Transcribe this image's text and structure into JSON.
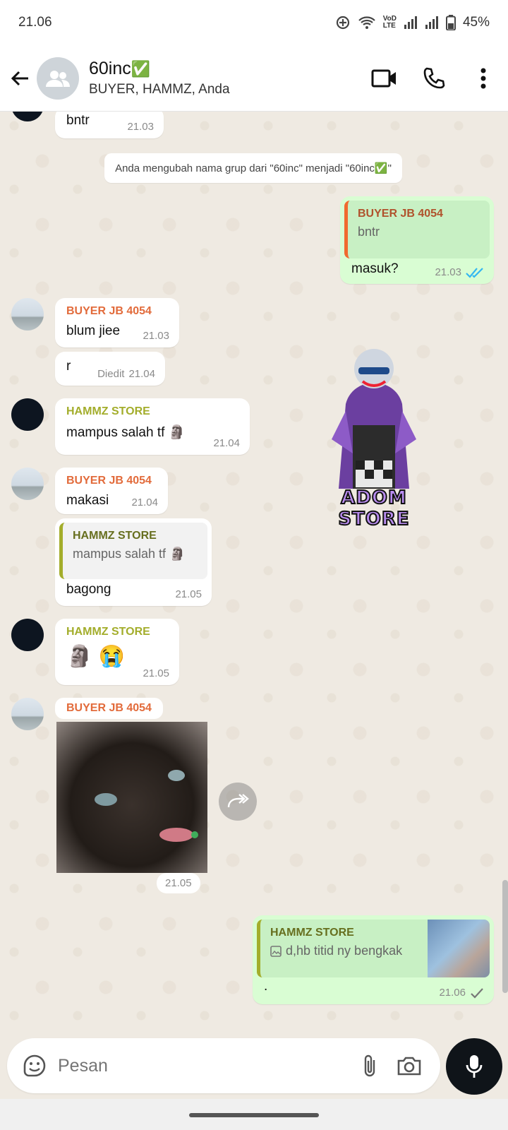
{
  "status_bar": {
    "time": "21.06",
    "battery": "45%",
    "net_top": "VoD",
    "net_bottom": "LTE"
  },
  "header": {
    "title": "60inc",
    "title_emoji": "✅",
    "subtitle": "BUYER, HAMMZ, Anda",
    "icons": [
      "back-arrow-icon",
      "group-icon",
      "video-call-icon",
      "phone-icon",
      "more-vert-icon"
    ]
  },
  "messages": {
    "m1": {
      "text": "bntr",
      "time": "21.03"
    },
    "system": {
      "text": "Anda mengubah nama grup dari \"60inc\" menjadi \"60inc✅\""
    },
    "m2": {
      "quote_sender": "BUYER JB 4054",
      "quote_text": "bntr",
      "text": "masuk?",
      "time": "21.03",
      "status": "read"
    },
    "m3": {
      "sender": "BUYER JB 4054",
      "text": "blum jiee",
      "time": "21.03"
    },
    "m4": {
      "text": "r",
      "edited": "Diedit",
      "time": "21.04"
    },
    "m5": {
      "sender": "HAMMZ STORE",
      "text": "mampus salah tf 🗿",
      "time": "21.04"
    },
    "m6": {
      "sender": "BUYER JB 4054",
      "text": "makasi",
      "time": "21.04"
    },
    "m7": {
      "quote_sender": "HAMMZ STORE",
      "quote_text": "mampus salah tf 🗿",
      "text": "bagong",
      "time": "21.05"
    },
    "m8": {
      "sender": "HAMMZ STORE",
      "text": "🗿 😭",
      "time": "21.05"
    },
    "m9": {
      "sender": "BUYER JB 4054",
      "time": "21.05"
    },
    "m10": {
      "quote_sender": "HAMMZ STORE",
      "quote_text": "d,hb titid ny bengkak",
      "text": ".",
      "time": "21.06",
      "status": "sent"
    },
    "sticker_text": "ADOM STORE"
  },
  "composer": {
    "placeholder": "Pesan"
  },
  "colors": {
    "outgoing_bubble": "#d9fdd3",
    "incoming_bubble": "#ffffff",
    "buyer_name": "#e26b3b",
    "hammz_name": "#a3ad2b",
    "read_tick": "#34b7f1"
  }
}
